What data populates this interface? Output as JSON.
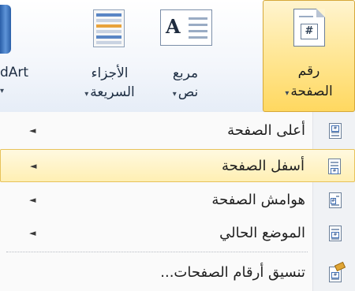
{
  "ribbon": {
    "page_number": {
      "line1": "رقم",
      "line2": "الصفحة",
      "icon_text": "#"
    },
    "text_box": {
      "line1": "مربع",
      "line2": "نص",
      "icon_text": "A"
    },
    "quick_parts": {
      "line1": "الأجزاء",
      "line2": "السريعة"
    },
    "wordart": {
      "label": "dArt"
    },
    "dropdown_caret": "▾"
  },
  "menu": {
    "items": [
      {
        "label": "أعلى الصفحة",
        "has_submenu": true,
        "arrow": "◄",
        "icon": "page-top-icon"
      },
      {
        "label": "أسفل الصفحة",
        "has_submenu": true,
        "arrow": "◄",
        "icon": "page-bottom-icon",
        "highlighted": true
      },
      {
        "label": "هوامش الصفحة",
        "has_submenu": true,
        "arrow": "◄",
        "icon": "page-margins-icon"
      },
      {
        "label": "الموضع الحالي",
        "has_submenu": true,
        "arrow": "◄",
        "icon": "current-position-icon"
      },
      {
        "label": "تنسيق أرقام الصفحات...",
        "has_submenu": false,
        "icon": "format-page-numbers-icon"
      }
    ]
  },
  "colors": {
    "highlight": "#ffefb3",
    "highlight_border": "#e7c25a",
    "ribbon_active": "#ffd860"
  }
}
